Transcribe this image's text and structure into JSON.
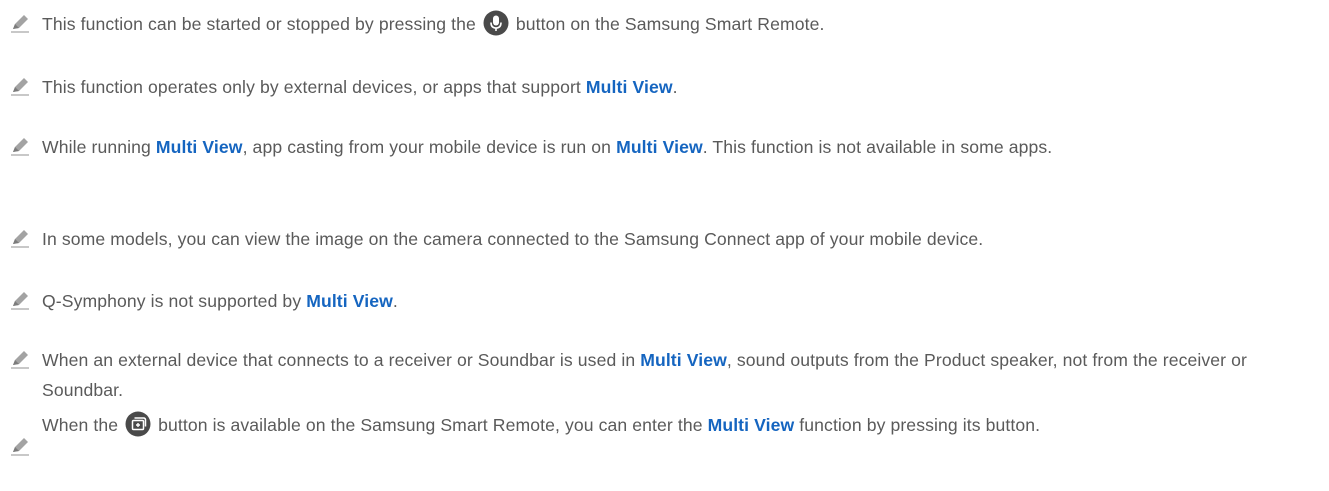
{
  "notes": [
    {
      "before": "This function can be started or stopped by pressing the ",
      "icon": "microphone-icon",
      "after": " button on the Samsung Smart Remote."
    },
    {
      "before": "This function operates only by external devices, or apps that support ",
      "link": "Multi View",
      "after": "."
    },
    {
      "before": "While running ",
      "link1": "Multi View",
      "middle": ", app casting from your mobile device is run on ",
      "link2": "Multi View",
      "after": ". This function is not available in some apps."
    },
    {
      "text": "In some models, you can view the image on the camera connected to the Samsung Connect app of your mobile device."
    },
    {
      "before": "Q-Symphony is not supported by ",
      "link": "Multi View",
      "after": "."
    },
    {
      "before": "When an external device that connects to a receiver or Soundbar is used in ",
      "link": "Multi View",
      "after": ", sound outputs from the Product speaker, not from the receiver or Soundbar."
    },
    {
      "before": "When the ",
      "icon": "multi-view-icon",
      "middle": " button is available on the Samsung Smart Remote, you can enter the ",
      "link": "Multi View",
      "after": " function by pressing its button."
    }
  ],
  "colors": {
    "text": "#5a5a5a",
    "link": "#1565c0",
    "pencil": "#9a9a9a",
    "button_icon": "#4a4a4a"
  }
}
